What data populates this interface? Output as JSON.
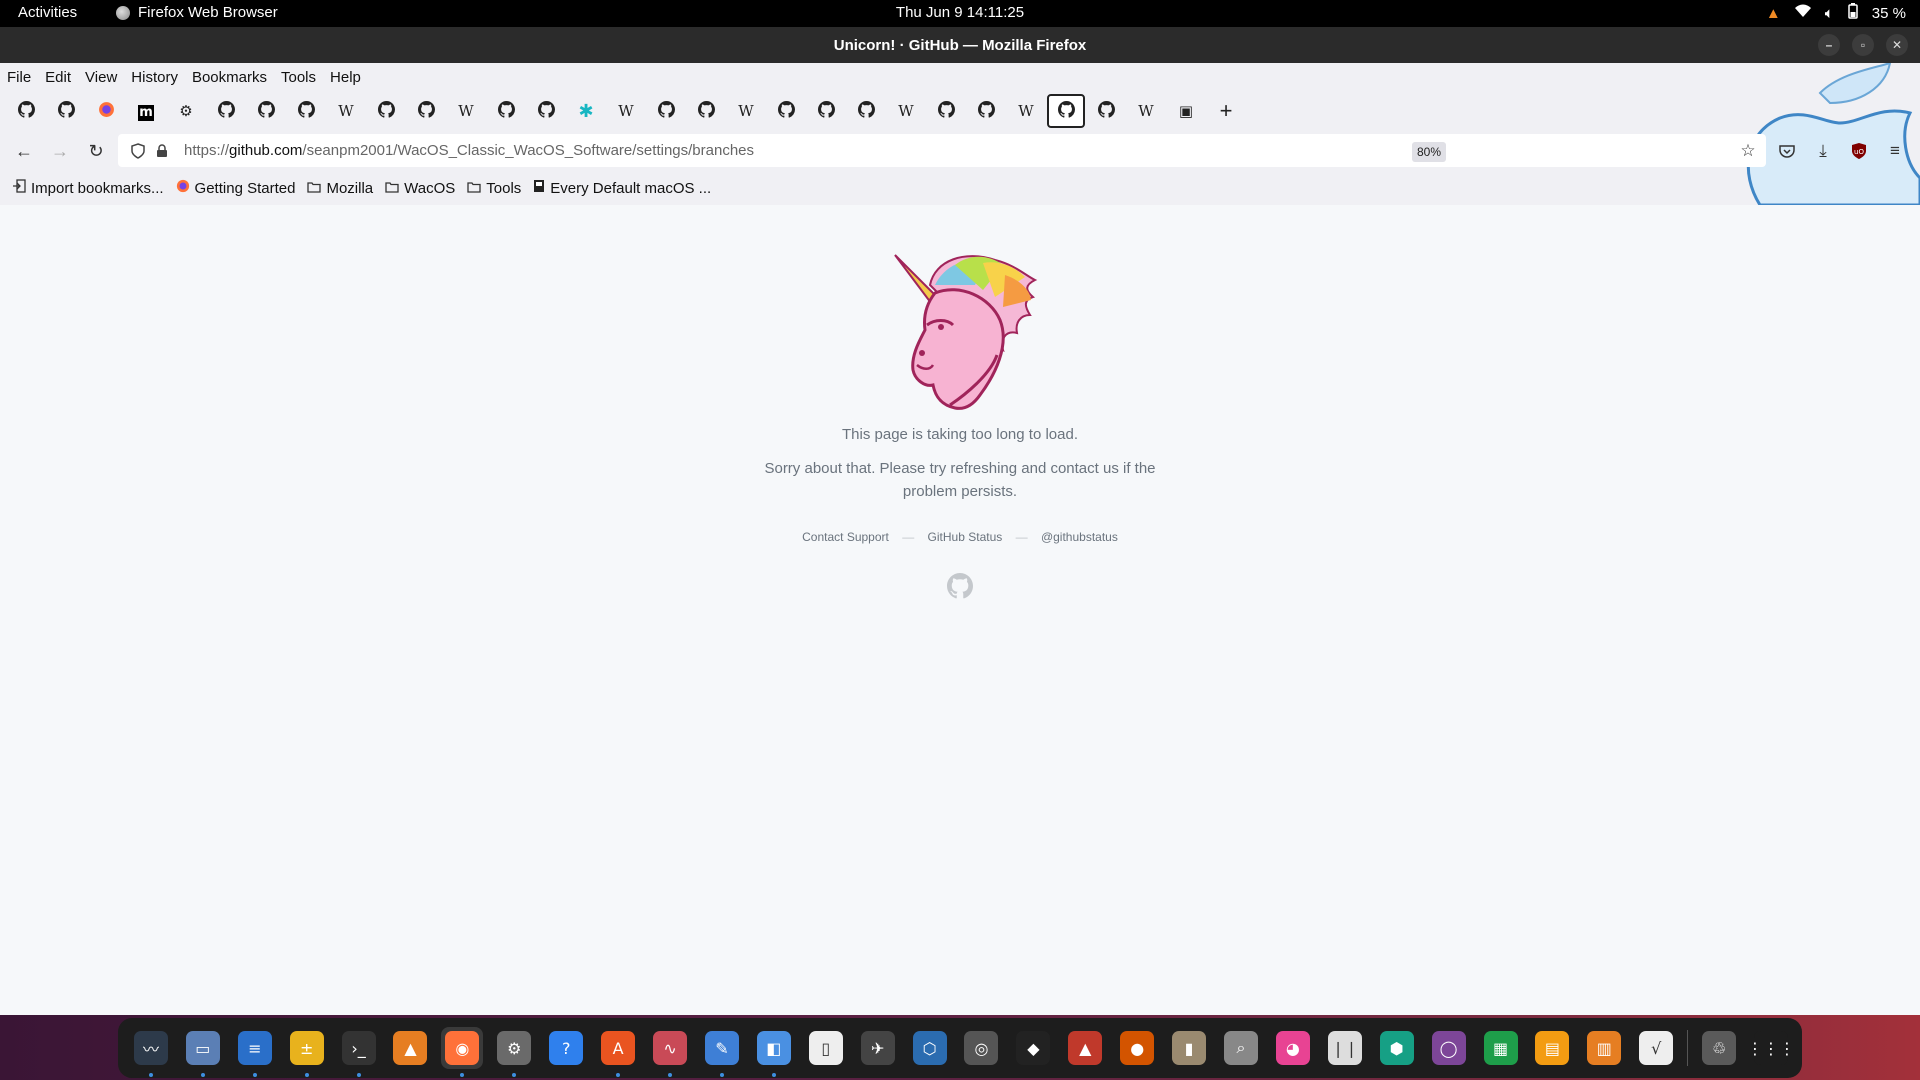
{
  "topbar": {
    "activities": "Activities",
    "app_name": "Firefox Web Browser",
    "clock": "Thu Jun 9  14:11:25",
    "battery": "35 %"
  },
  "window": {
    "title": "Unicorn! · GitHub — Mozilla Firefox"
  },
  "menubar": {
    "items": [
      {
        "label": "File"
      },
      {
        "label": "Edit"
      },
      {
        "label": "View"
      },
      {
        "label": "History"
      },
      {
        "label": "Bookmarks"
      },
      {
        "label": "Tools"
      },
      {
        "label": "Help"
      }
    ]
  },
  "tabs": [
    {
      "icon": "github-icon"
    },
    {
      "icon": "github-icon"
    },
    {
      "icon": "firefox-icon"
    },
    {
      "icon": "medium-icon",
      "text": "m"
    },
    {
      "icon": "gear-icon",
      "text": "⚙"
    },
    {
      "icon": "github-icon"
    },
    {
      "icon": "github-icon"
    },
    {
      "icon": "github-icon"
    },
    {
      "icon": "wikipedia-icon",
      "text": "W"
    },
    {
      "icon": "github-icon"
    },
    {
      "icon": "github-icon"
    },
    {
      "icon": "wikipedia-icon",
      "text": "W"
    },
    {
      "icon": "github-icon"
    },
    {
      "icon": "github-icon"
    },
    {
      "icon": "puzzle-icon",
      "text": "✱"
    },
    {
      "icon": "wikipedia-icon",
      "text": "W"
    },
    {
      "icon": "github-icon"
    },
    {
      "icon": "github-icon"
    },
    {
      "icon": "wikipedia-icon",
      "text": "W"
    },
    {
      "icon": "github-icon"
    },
    {
      "icon": "github-icon"
    },
    {
      "icon": "github-icon"
    },
    {
      "icon": "wikipedia-icon",
      "text": "W"
    },
    {
      "icon": "github-icon"
    },
    {
      "icon": "github-icon"
    },
    {
      "icon": "wikipedia-icon",
      "text": "W"
    },
    {
      "icon": "github-icon",
      "active": true
    },
    {
      "icon": "github-icon"
    },
    {
      "icon": "wikipedia-icon",
      "text": "W"
    },
    {
      "icon": "page-icon",
      "text": "▣"
    }
  ],
  "new_tab": "+",
  "url": {
    "scheme": "https://",
    "host": "github.com",
    "path": "/seanpm2001/WacOS_Classic_WacOS_Software/settings/branches"
  },
  "zoom": "80%",
  "bookmarks": [
    {
      "label": "Import bookmarks...",
      "icon": "import-icon"
    },
    {
      "label": "Getting Started",
      "icon": "firefox-icon"
    },
    {
      "label": "Mozilla",
      "icon": "folder-icon"
    },
    {
      "label": "WacOS",
      "icon": "folder-icon"
    },
    {
      "label": "Tools",
      "icon": "folder-icon"
    },
    {
      "label": "Every Default macOS ...",
      "icon": "page-icon"
    }
  ],
  "content": {
    "message_primary": "This page is taking too long to load.",
    "message_secondary": "Sorry about that. Please try refreshing and contact us if the problem persists.",
    "link_support": "Contact Support",
    "link_status": "GitHub Status",
    "link_twitter": "@githubstatus",
    "separator": "—"
  },
  "dock": [
    {
      "name": "system-monitor",
      "color": "#2d3a4a",
      "glyph": "〰",
      "dot": true
    },
    {
      "name": "files",
      "color": "#5b7fb5",
      "glyph": "▭",
      "dot": true
    },
    {
      "name": "writer",
      "color": "#2a6fc9",
      "glyph": "≡",
      "dot": true
    },
    {
      "name": "calculator",
      "color": "#e8b21d",
      "glyph": "±",
      "dot": true
    },
    {
      "name": "terminal",
      "color": "#333333",
      "glyph": "›_",
      "dot": true
    },
    {
      "name": "vlc",
      "color": "#e67e22",
      "glyph": "▲",
      "dot": false
    },
    {
      "name": "firefox",
      "color": "#ff7139",
      "glyph": "◉",
      "dot": true,
      "active": true
    },
    {
      "name": "settings",
      "color": "#6a6a6a",
      "glyph": "⚙",
      "dot": true
    },
    {
      "name": "help",
      "color": "#2f80ed",
      "glyph": "?",
      "dot": false
    },
    {
      "name": "software",
      "color": "#e95420",
      "glyph": "A",
      "dot": true
    },
    {
      "name": "monitor",
      "color": "#c94a57",
      "glyph": "∿",
      "dot": true
    },
    {
      "name": "text-editor",
      "color": "#3e7fd6",
      "glyph": "✎",
      "dot": true
    },
    {
      "name": "control-center",
      "color": "#4a90e2",
      "glyph": "◧",
      "dot": true
    },
    {
      "name": "document",
      "color": "#eeeeee",
      "glyph": "▯",
      "dot": false
    },
    {
      "name": "grinder",
      "color": "#444444",
      "glyph": "✈",
      "dot": false
    },
    {
      "name": "virtualbox",
      "color": "#2b6cb0",
      "glyph": "⬡",
      "dot": false
    },
    {
      "name": "speaker",
      "color": "#555555",
      "glyph": "◎",
      "dot": false
    },
    {
      "name": "inkscape",
      "color": "#222222",
      "glyph": "◆",
      "dot": false
    },
    {
      "name": "racer",
      "color": "#c0392b",
      "glyph": "▲",
      "dot": false
    },
    {
      "name": "mario",
      "color": "#d35400",
      "glyph": "●",
      "dot": false
    },
    {
      "name": "archive",
      "color": "#9a8a70",
      "glyph": "▮",
      "dot": false
    },
    {
      "name": "viewer",
      "color": "#888888",
      "glyph": "⌕",
      "dot": false
    },
    {
      "name": "color-picker",
      "color": "#e84393",
      "glyph": "◕",
      "dot": false
    },
    {
      "name": "books",
      "color": "#dddddd",
      "glyph": "❘❘",
      "dot": false
    },
    {
      "name": "3d-box",
      "color": "#16a085",
      "glyph": "⬢",
      "dot": false
    },
    {
      "name": "tor",
      "color": "#7d4698",
      "glyph": "◯",
      "dot": false
    },
    {
      "name": "calc-sheet",
      "color": "#1e9e4a",
      "glyph": "▦",
      "dot": false
    },
    {
      "name": "impress",
      "color": "#f39c12",
      "glyph": "▤",
      "dot": false
    },
    {
      "name": "presentation",
      "color": "#e67e22",
      "glyph": "▥",
      "dot": false
    },
    {
      "name": "math",
      "color": "#eeeeee",
      "glyph": "√",
      "dot": false
    },
    {
      "name": "trash",
      "color": "#5a5a5a",
      "glyph": "♲",
      "dot": false,
      "separator_before": true
    },
    {
      "name": "app-grid",
      "color": "#1d1d1d",
      "glyph": "⋮⋮⋮",
      "dot": false
    }
  ]
}
